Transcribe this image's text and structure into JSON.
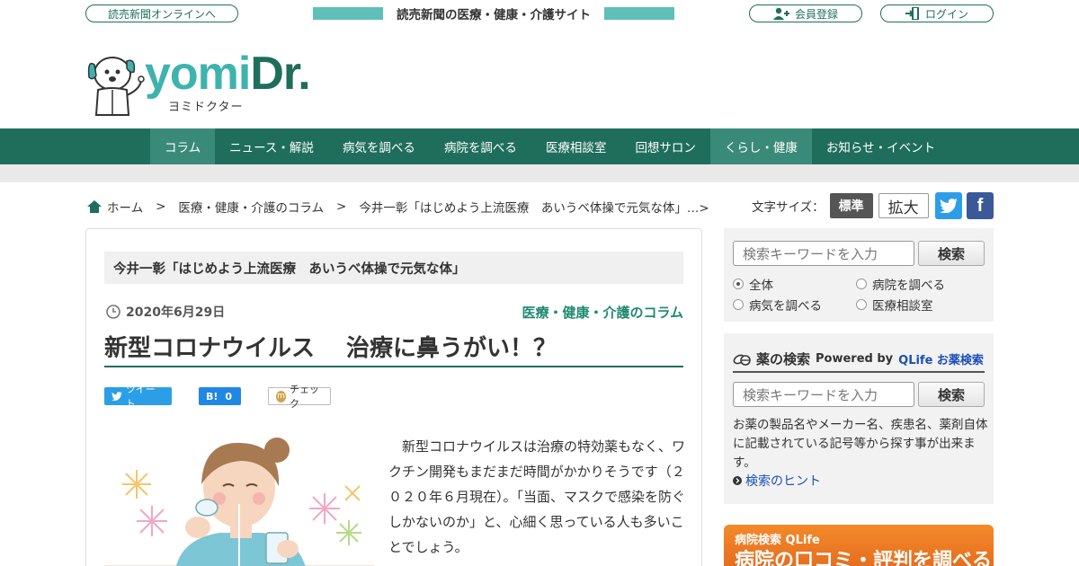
{
  "topbar": {
    "online_link": "読売新聞オンラインへ",
    "tagline": "読売新聞の医療・健康・介護サイト",
    "register": "会員登録",
    "login": "ログイン"
  },
  "logo": {
    "main_a": "yomi",
    "main_b": "Dr.",
    "sub": "ヨミドクター"
  },
  "nav": {
    "items": [
      "コラム",
      "ニュース・解説",
      "病気を調べる",
      "病院を調べる",
      "医療相談室",
      "回想サロン",
      "くらし・健康",
      "お知らせ・イベント"
    ]
  },
  "breadcrumb": {
    "home": "ホーム",
    "sep": ">",
    "level1": "医療・健康・介護のコラム",
    "level2": "今井一彰「はじめよう上流医療　あいうべ体操で元気な体」…>"
  },
  "font_size": {
    "label": "文字サイズ：",
    "standard": "標準",
    "large": "拡大"
  },
  "article": {
    "series": "今井一彰「はじめよう上流医療　あいうべ体操で元気な体」",
    "date": "2020年6月29日",
    "category": "医療・健康・介護のコラム",
    "title": "新型コロナウイルス　 治療に鼻うがい！？",
    "share_tweet": "ツイート",
    "share_hatena": "B!",
    "share_hatena_count": "0",
    "share_mixi": "チェック",
    "body": "新型コロナウイルスは治療の特効薬もなく、ワクチン開発もまだまだ時間がかかりそうです（２０２０年６月現在）。「当面、マスクで感染を防ぐしかないのか」と、心細く思っている人も多いことでしょう。"
  },
  "site_search": {
    "placeholder": "検索キーワードを入力",
    "button": "検索",
    "options": [
      "全体",
      "病院を調べる",
      "病気を調べる",
      "医療相談室"
    ]
  },
  "drug_search": {
    "title": "薬の検索",
    "powered": "Powered by",
    "provider": "QLife お薬検索",
    "placeholder": "検索キーワードを入力",
    "button": "検索",
    "description": "お薬の製品名やメーカー名、疾患名、薬剤自体に記載されている記号等から探す事が出来ます。",
    "hint": "検索のヒント"
  },
  "banner": {
    "small": "病院検索 QLife",
    "big": "病院の口コミ・評判を調べる"
  },
  "colors": {
    "brand_green": "#1f6e5c",
    "accent_teal": "#5fbfb9",
    "banner_orange": "#f28a2a"
  }
}
